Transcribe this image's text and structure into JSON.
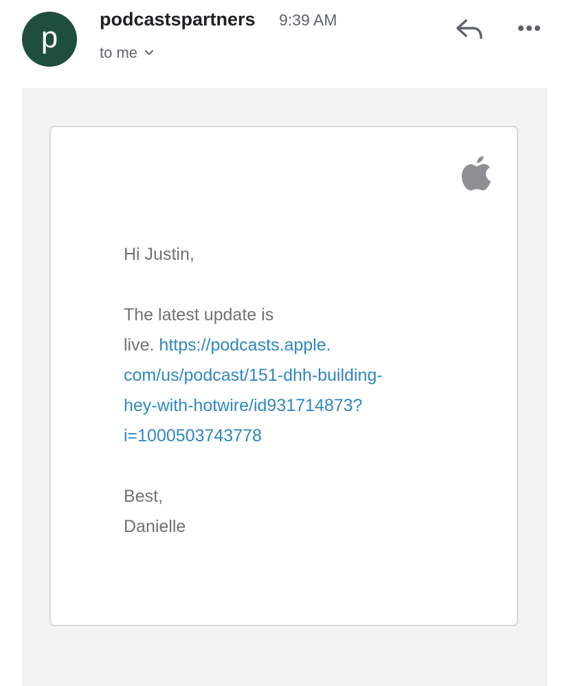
{
  "header": {
    "avatar_letter": "p",
    "sender": "podcastspartners",
    "time": "9:39 AM",
    "recipient": "to me",
    "reply_icon": "reply-icon",
    "more_icon": "more-options-icon"
  },
  "email": {
    "logo_icon": "apple-logo-icon",
    "greeting": "Hi Justin,",
    "para_line1": "The latest update is",
    "para_line2_prefix": "live.",
    "link_line1": "https://podcasts.apple.",
    "link_line2": "com/us/podcast/151-dhh-building-",
    "link_line3": "hey-with-hotwire/id931714873?",
    "link_line4": "i=1000503743778",
    "signoff": "Best,",
    "signature": "Danielle"
  },
  "colors": {
    "avatar": "#1f4d3e",
    "link": "#2f87c0",
    "body_text": "#717171",
    "email_background": "#f2f2f2"
  }
}
